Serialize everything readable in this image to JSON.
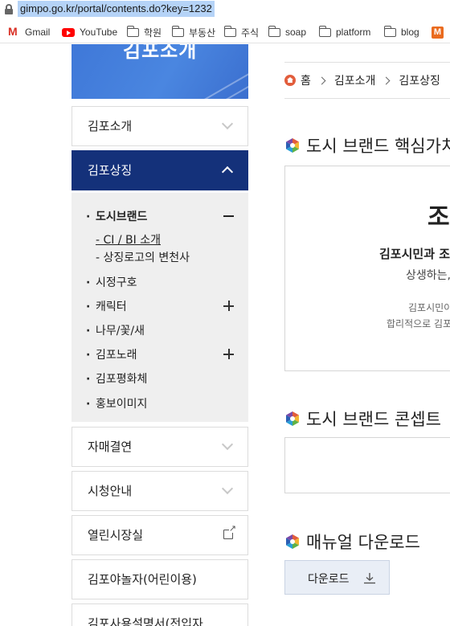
{
  "browser": {
    "url": "gimpo.go.kr/portal/contents.do?key=1232",
    "bookmarks": [
      {
        "label": "Gmail",
        "icon": "gmail-icon"
      },
      {
        "label": "YouTube",
        "icon": "youtube-icon"
      },
      {
        "label": "학원",
        "icon": "folder-icon"
      },
      {
        "label": "부동산",
        "icon": "folder-icon"
      },
      {
        "label": "주식",
        "icon": "folder-icon"
      },
      {
        "label": "soap",
        "icon": "folder-icon"
      },
      {
        "label": "platform",
        "icon": "folder-icon"
      },
      {
        "label": "blog",
        "icon": "folder-icon"
      },
      {
        "label": "M",
        "icon": "m-app-icon"
      }
    ]
  },
  "sidebar": {
    "banner_title": "김포소개",
    "items": [
      {
        "label": "김포소개"
      },
      {
        "label": "김포상징"
      },
      {
        "label": "자매결연"
      },
      {
        "label": "시청안내"
      },
      {
        "label": "열린시장실"
      },
      {
        "label": "김포야놀자(어린이용)"
      },
      {
        "label": "김포사용설명서(전입자"
      }
    ],
    "submenu": [
      {
        "label": "도시브랜드"
      },
      {
        "label": "CI / BI 소개"
      },
      {
        "label": "상징로고의 변천사"
      },
      {
        "label": "시정구호"
      },
      {
        "label": "캐릭터"
      },
      {
        "label": "나무/꽃/새"
      },
      {
        "label": "김포노래"
      },
      {
        "label": "김포평화체"
      },
      {
        "label": "홍보이미지"
      }
    ]
  },
  "breadcrumb": [
    "홈",
    "김포소개",
    "김포상징"
  ],
  "sections": {
    "core_values_title": "도시 브랜드 핵심가치",
    "core_values_box": {
      "big": "조",
      "line1": "김포시민과 조",
      "line2": "상생하는,",
      "line3": "김포시민이",
      "line4": "합리적으로 김포"
    },
    "concept_title": "도시 브랜드 콘셉트",
    "manual_title": "매뉴얼 다운로드",
    "download_label": "다운로드"
  },
  "colors": {
    "active_nav": "#14317a",
    "banner": "#4a86e0",
    "submenu_bg": "#efefef",
    "download_btn": "#e9eef6"
  }
}
